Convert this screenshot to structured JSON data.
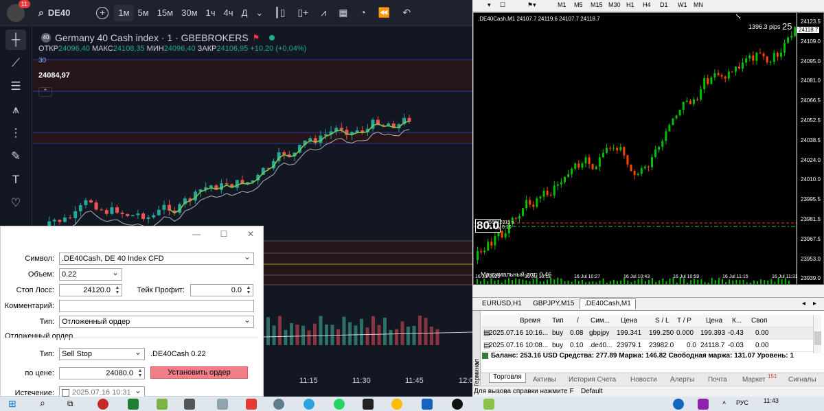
{
  "left_app": {
    "notification_count": "11",
    "symbol": "DE40",
    "timeframes": [
      "1м",
      "5м",
      "15м",
      "30м",
      "1ч",
      "4ч",
      "Д"
    ],
    "active_timeframe": "1м",
    "instrument_title": "Germany 40 Cash index · 1 · GBEBROKERS",
    "instrument_icon_text": "40",
    "ohlc": {
      "open_label": "ОТКР",
      "open": "24096,40",
      "high_label": "МАКС",
      "high": "24108,35",
      "low_label": "МИН",
      "low": "24096,40",
      "close_label": "ЗАКР",
      "close": "24106,95",
      "change": "+10,20 (+0,04%)"
    },
    "level_label": "30",
    "price_label": "24084,97",
    "time_labels": [
      "11:15",
      "11:30",
      "11:45",
      "12:0"
    ]
  },
  "order_dialog": {
    "symbol_label": "Символ:",
    "symbol_value": ".DE40Cash, DE 40 Index CFD",
    "volume_label": "Объем:",
    "volume_value": "0.22",
    "sl_label": "Стоп Лосс:",
    "sl_value": "24120.0",
    "tp_label": "Тейк Профит:",
    "tp_value": "0.0",
    "comment_label": "Комментарий:",
    "comment_value": "",
    "type_label": "Тип:",
    "type_value": "Отложенный ордер",
    "pending_section": "Отложенный ордер",
    "pending_type_label": "Тип:",
    "pending_type_value": "Sell Stop",
    "pending_info": ".DE40Cash 0.22",
    "price_label": "по цене:",
    "price_value": "24080.0",
    "submit_label": "Установить ордер",
    "expiry_label": "Истечение:",
    "expiry_value": "2025.07.16 10:31"
  },
  "mt4": {
    "timeframes": [
      "M1",
      "M5",
      "M15",
      "M30",
      "H1",
      "H4",
      "D1",
      "W1",
      "MN"
    ],
    "chart_header": ".DE40Cash,M1  24107.7 24119.6 24107.7 24118.7",
    "pips_label": "1396.3 pips",
    "pips_big": "25",
    "current_price": "24118.7",
    "price_axis": [
      "24123.5",
      "24109.0",
      "24095.0",
      "24081.0",
      "24066.5",
      "24052.5",
      "24038.5",
      "24024.0",
      "24010.0",
      "23995.5",
      "23981.5",
      "23967.5",
      "23953.0",
      "23939.0"
    ],
    "time_axis": [
      "16 Jul 2025",
      "16 Jul 10:11",
      "16 Jul 10:27",
      "16 Jul 10:43",
      "16 Jul 10:59",
      "16 Jul 11:15",
      "16 Jul 11:31"
    ],
    "big_number": "80.0",
    "order_line_label": "#56812315 s",
    "buy_line_label": "#5 buy 0.10",
    "max_lot": "Максимальный лот: 0.46",
    "chart_tabs": [
      "EURUSD,H1",
      "GBPJPY,M15",
      ".DE40Cash,M1"
    ],
    "active_chart_tab": ".DE40Cash,M1",
    "terminal_label": "Терминал",
    "table_headers": [
      "Время",
      "Тип",
      "/",
      "Сим...",
      "Цена",
      "S / L",
      "T / P",
      "Цена",
      "К...",
      "Своп"
    ],
    "rows": [
      [
        "2025.07.16 10:16...",
        "buy",
        "0.08",
        "gbpjpy",
        "199.341",
        "199.250",
        "0.000",
        "199.393",
        "-0.43",
        "0.00"
      ],
      [
        "2025.07.16 10:08...",
        "buy",
        "0.10",
        ".de40...",
        "23979.1",
        "23982.0",
        "0.0",
        "24118.7",
        "-0.03",
        "0.00"
      ]
    ],
    "balance_line": "Баланс: 253.16 USD  Средства: 277.89  Маржа: 146.82  Свободная маржа: 131.07  Уровень: 1",
    "bottom_tabs": [
      "Торговля",
      "Активы",
      "История Счета",
      "Новости",
      "Алерты",
      "Почта",
      "Маркет",
      "Сигналы"
    ],
    "market_badge": "151",
    "status_left": "Для вызова справки нажмите F",
    "status_right": "Default"
  },
  "taskbar": {
    "lang": "РУС",
    "time": "11:43"
  },
  "colors": {
    "tv_bg": "#131722",
    "up": "#26a69a",
    "down": "#ef5350",
    "mt_up": "#00c000",
    "mt_down": "#ff4500",
    "submit": "#f07f8a"
  }
}
